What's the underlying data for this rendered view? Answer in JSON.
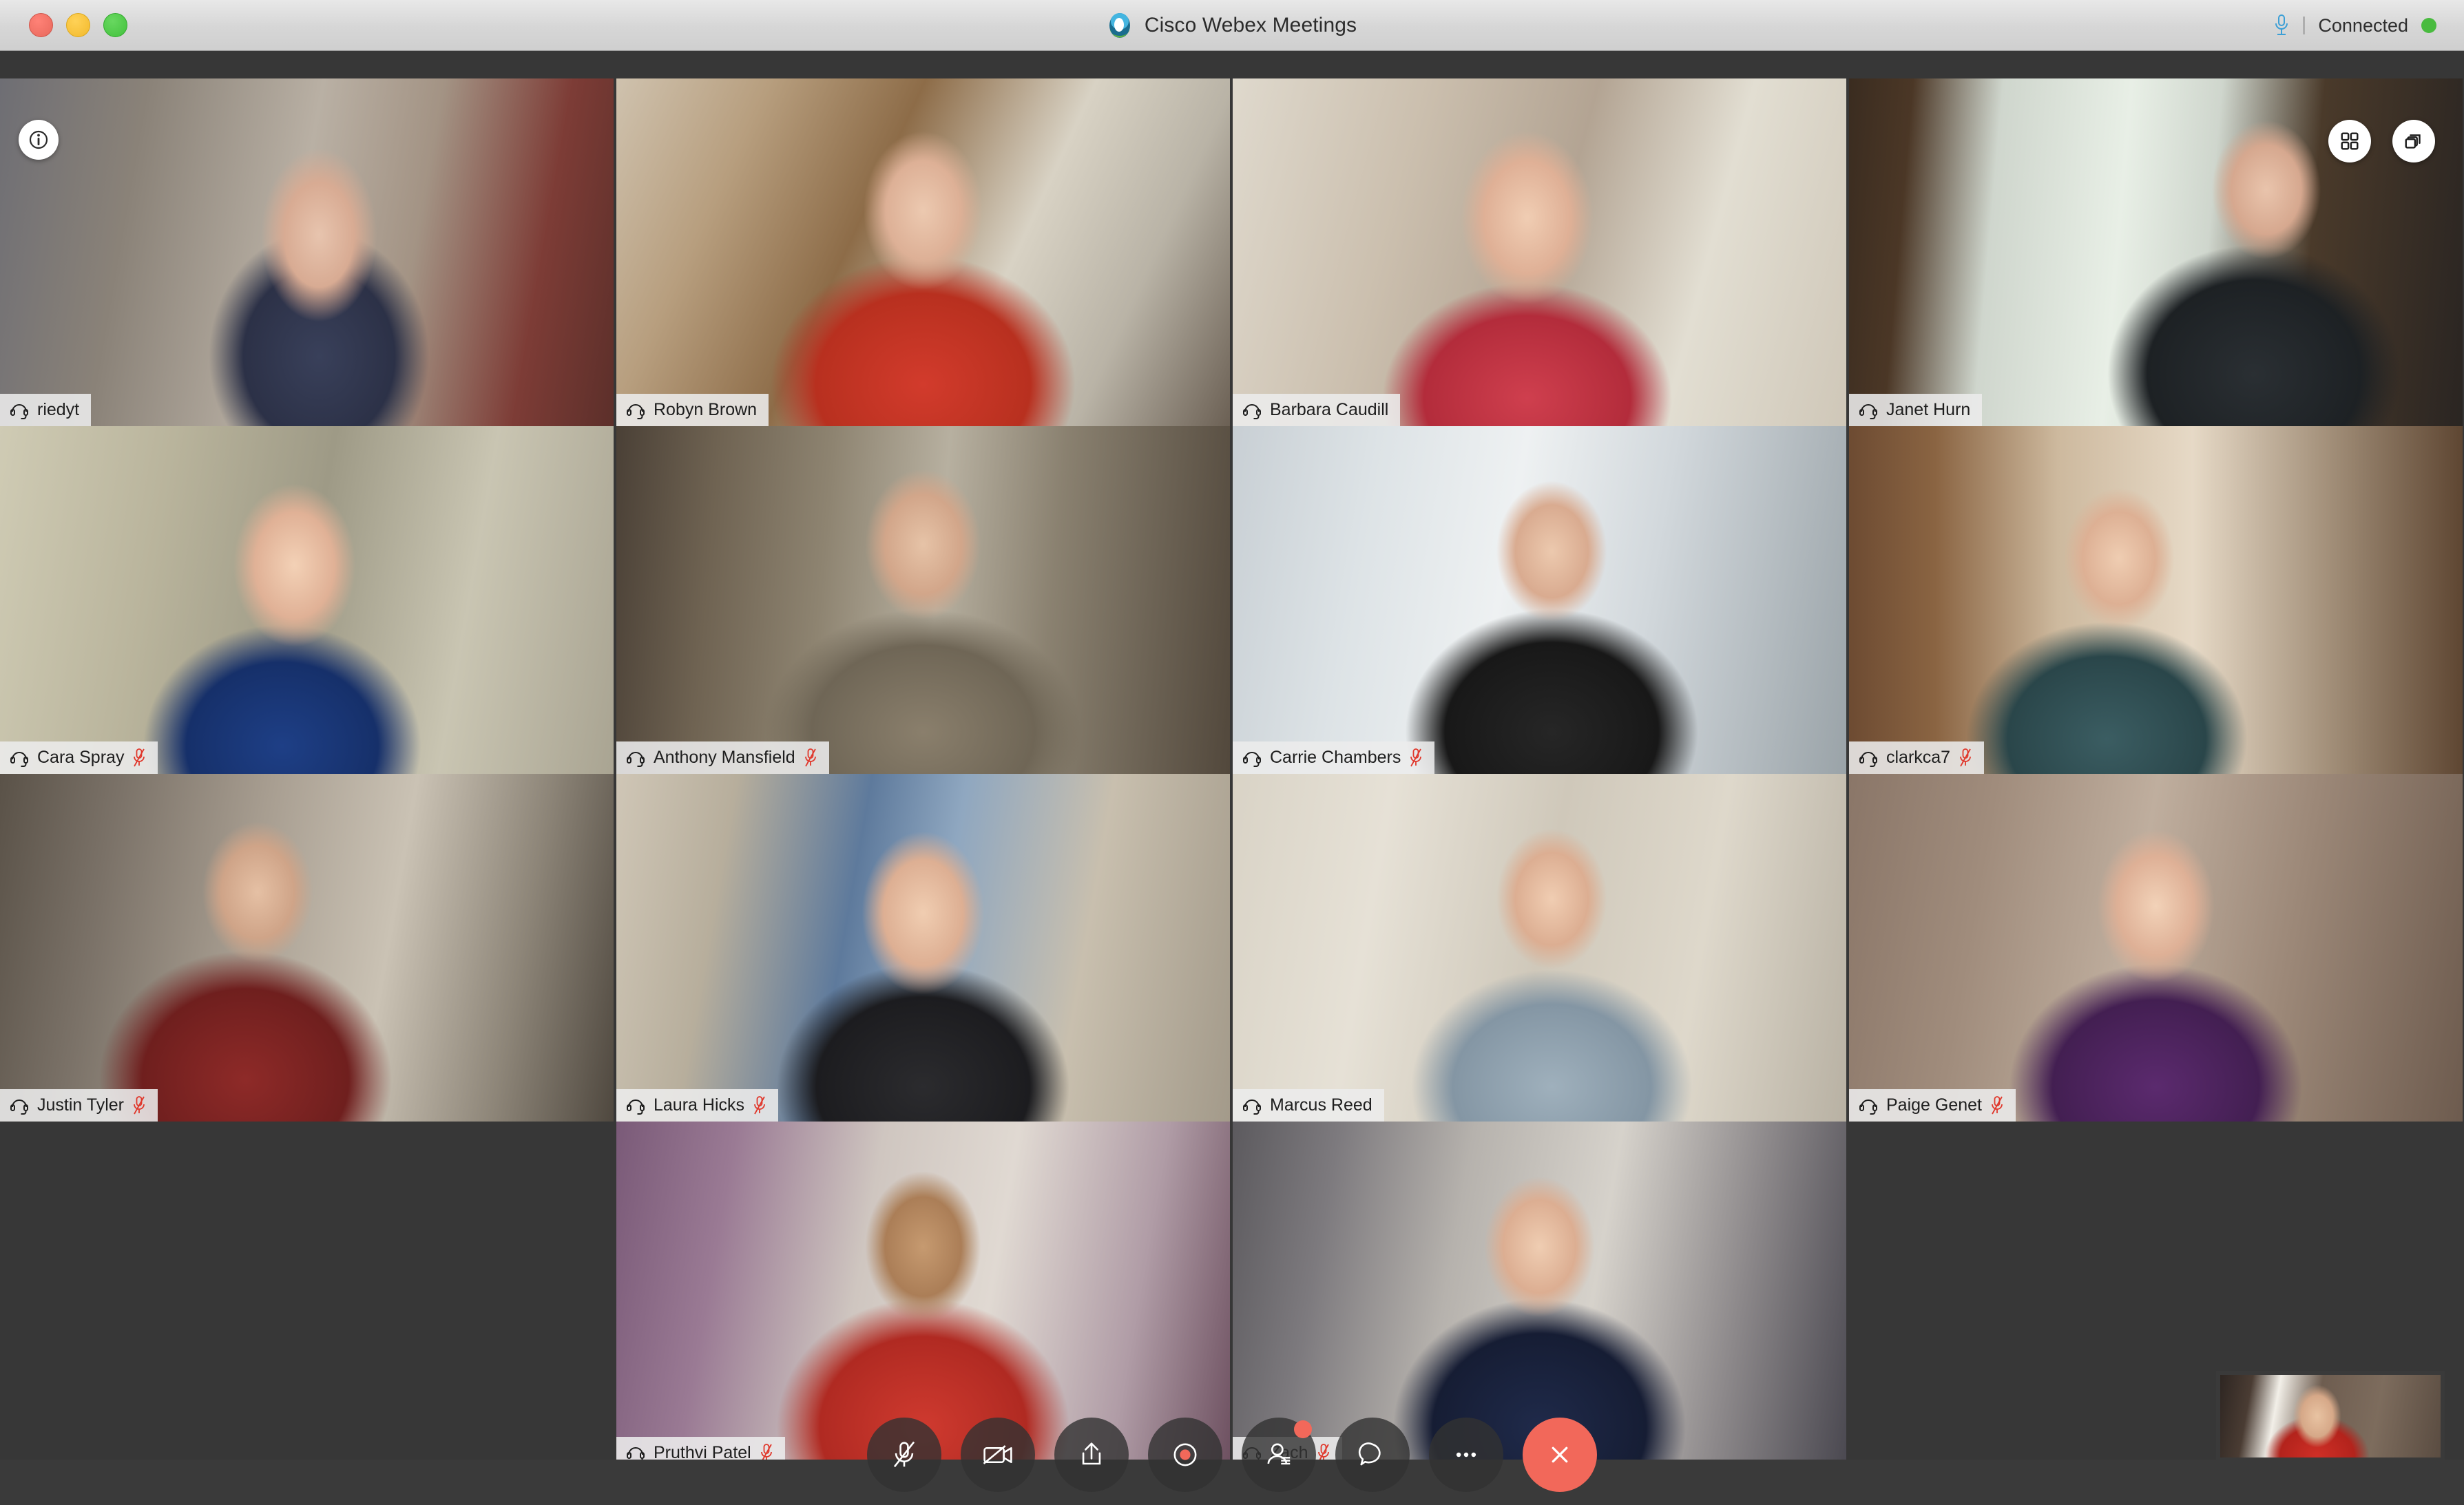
{
  "window": {
    "app_title": "Cisco Webex Meetings",
    "connection_status": "Connected",
    "traffic_lights": [
      "close",
      "minimize",
      "maximize"
    ],
    "mic_icon": "microphone-icon",
    "status_dot_color": "#49bb3f"
  },
  "overlay": {
    "info_label": "i",
    "info_icon": "info-icon",
    "grid_view_icon": "grid-view-icon",
    "layout_icon": "layout-stack-icon"
  },
  "participants": [
    {
      "name": "riedyt",
      "muted": false,
      "active_speaker": false,
      "video": "v1"
    },
    {
      "name": "Robyn Brown",
      "muted": false,
      "active_speaker": false,
      "video": "v2"
    },
    {
      "name": "Barbara Caudill",
      "muted": false,
      "active_speaker": false,
      "video": "v3"
    },
    {
      "name": "Janet Hurn",
      "muted": false,
      "active_speaker": true,
      "video": "v4"
    },
    {
      "name": "Cara Spray",
      "muted": true,
      "active_speaker": false,
      "video": "v5"
    },
    {
      "name": "Anthony Mansfield",
      "muted": true,
      "active_speaker": false,
      "video": "v6"
    },
    {
      "name": "Carrie Chambers",
      "muted": true,
      "active_speaker": false,
      "video": "v7"
    },
    {
      "name": "clarkca7",
      "muted": true,
      "active_speaker": false,
      "video": "v8b"
    },
    {
      "name": "Justin Tyler",
      "muted": true,
      "active_speaker": false,
      "video": "v9"
    },
    {
      "name": "Laura Hicks",
      "muted": true,
      "active_speaker": false,
      "video": "v10"
    },
    {
      "name": "Marcus Reed",
      "muted": false,
      "active_speaker": false,
      "video": "v11"
    },
    {
      "name": "Paige Genet",
      "muted": true,
      "active_speaker": false,
      "video": "v12"
    },
    {
      "name": "Pruthvi Patel",
      "muted": true,
      "active_speaker": false,
      "video": "v13"
    },
    {
      "name": "Zach",
      "muted": true,
      "active_speaker": false,
      "video": "v14"
    }
  ],
  "grid": {
    "columns": 4,
    "rows": 4,
    "total_visible": 14
  },
  "controls": [
    {
      "name": "mute-button",
      "icon": "microphone-muted-icon",
      "state": "muted"
    },
    {
      "name": "video-button",
      "icon": "video-camera-off-icon",
      "state": "off"
    },
    {
      "name": "share-button",
      "icon": "share-screen-icon",
      "state": "idle"
    },
    {
      "name": "record-button",
      "icon": "record-icon",
      "state": "idle"
    },
    {
      "name": "participants-button",
      "icon": "participants-icon",
      "state": "badge"
    },
    {
      "name": "chat-button",
      "icon": "chat-bubble-icon",
      "state": "idle"
    },
    {
      "name": "more-button",
      "icon": "more-options-icon",
      "state": "idle"
    },
    {
      "name": "end-meeting-button",
      "icon": "end-call-icon",
      "state": "danger"
    }
  ],
  "selfview": {
    "label": "self-view"
  },
  "colors": {
    "active_speaker_border": "#2196d4",
    "end_call": "#f2685a",
    "muted_mic": "#e0372b",
    "stage_background": "#373737",
    "namebar_background": "#ececec"
  }
}
